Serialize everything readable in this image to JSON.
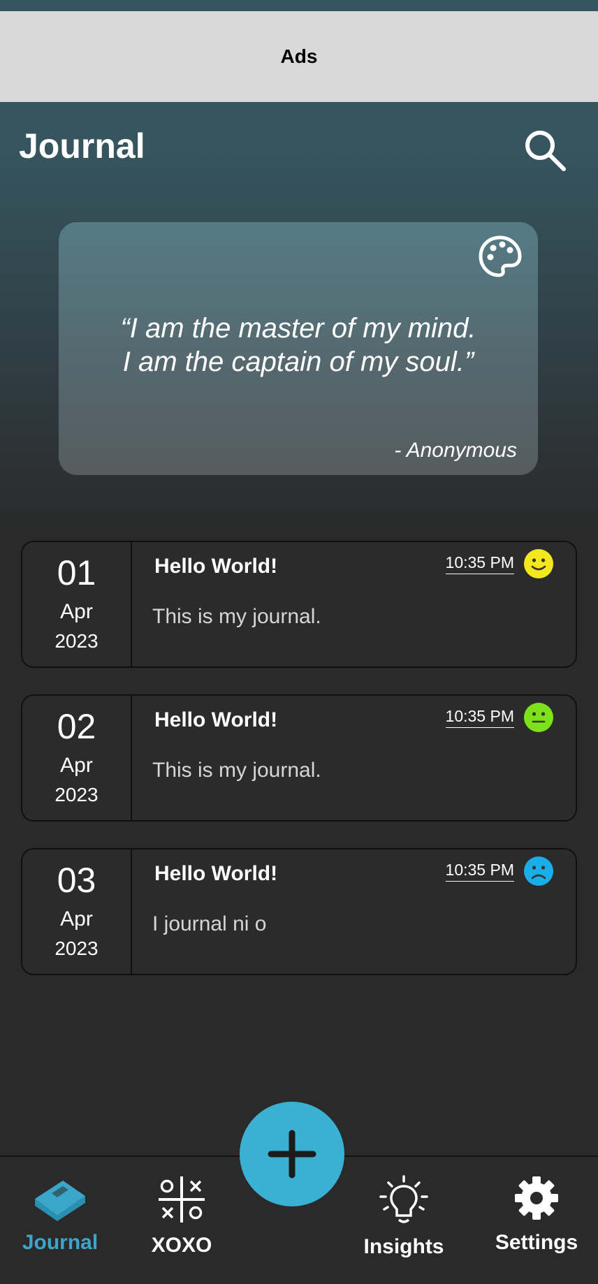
{
  "ads": {
    "label": "Ads"
  },
  "header": {
    "title": "Journal",
    "search_icon": "search-icon"
  },
  "quote": {
    "text": "“I am the master of my mind.\nI am the captain of my soul.”",
    "author": "- Anonymous",
    "theme_icon": "palette-icon"
  },
  "entries": [
    {
      "day": "01",
      "month": "Apr",
      "year": "2023",
      "title": "Hello World!",
      "body": "This is my journal.",
      "time": "10:35 PM",
      "mood": "happy",
      "mood_color": "#f2e81c"
    },
    {
      "day": "02",
      "month": "Apr",
      "year": "2023",
      "title": "Hello World!",
      "body": "This is my journal.",
      "time": "10:35 PM",
      "mood": "neutral",
      "mood_color": "#7ee21a"
    },
    {
      "day": "03",
      "month": "Apr",
      "year": "2023",
      "title": "Hello World!",
      "body": "I journal ni o",
      "time": "10:35 PM",
      "mood": "sad",
      "mood_color": "#1aaee8"
    }
  ],
  "nav": {
    "items": [
      {
        "label": "Journal",
        "icon": "book-icon",
        "active": true
      },
      {
        "label": "XOXO",
        "icon": "tic-tac-toe-icon",
        "active": false
      },
      {
        "label": "Insights",
        "icon": "lightbulb-icon",
        "active": false
      },
      {
        "label": "Settings",
        "icon": "gear-icon",
        "active": false
      }
    ],
    "fab_icon": "plus-icon"
  },
  "colors": {
    "accent": "#3ab0d2",
    "active_nav": "#3aa6c9",
    "background": "#2a2a2a"
  }
}
